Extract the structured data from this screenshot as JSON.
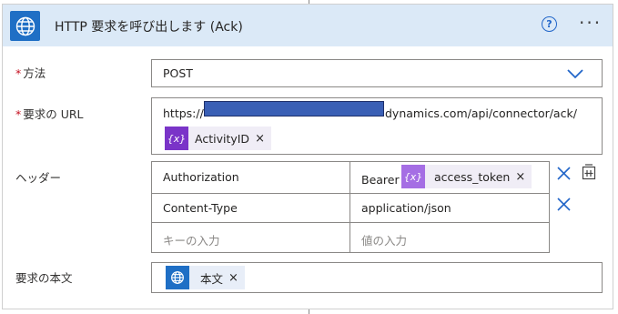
{
  "header": {
    "title": "HTTP 要求を呼び出します (Ack)",
    "help_glyph": "?",
    "more_glyph": "···"
  },
  "method": {
    "label": "方法",
    "required_mark": "*",
    "value": "POST"
  },
  "url": {
    "label": "要求の URL",
    "required_mark": "*",
    "prefix": "https://",
    "suffix": "dynamics.com/api/connector/ack/",
    "token": {
      "label": "ActivityID",
      "icon_text": "{x}",
      "close": "×"
    }
  },
  "headers": {
    "label": "ヘッダー",
    "rows": [
      {
        "key": "Authorization",
        "value_prefix": "Bearer",
        "token": {
          "label": "access_token",
          "icon_text": "{x}",
          "close": "×"
        }
      },
      {
        "key": "Content-Type",
        "value": "application/json"
      },
      {
        "key_placeholder": "キーの入力",
        "value_placeholder": "値の入力"
      }
    ]
  },
  "body": {
    "label": "要求の本文",
    "token": {
      "label": "本文",
      "close": "×"
    }
  },
  "colors": {
    "header_bg": "#dbe9f7",
    "accent_blue": "#1f6fc5",
    "variable_purple": "#7a34c8",
    "variable_purple_light": "#a56ee4",
    "chip_bg": "#f0edf6",
    "required_red": "#c50f1f"
  }
}
